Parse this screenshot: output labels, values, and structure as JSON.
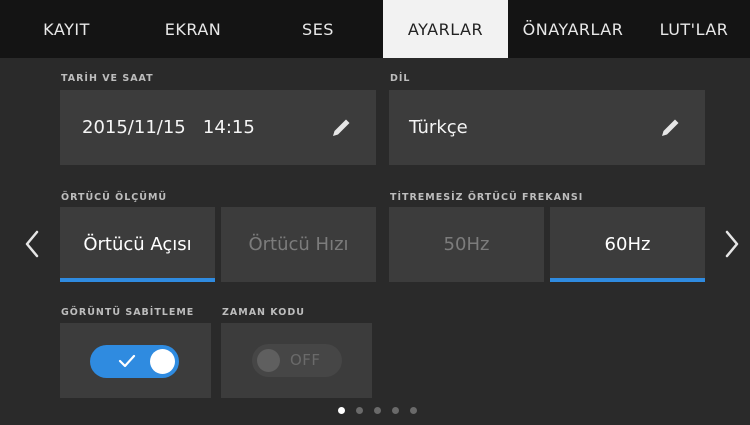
{
  "tabs": [
    {
      "label": "KAYIT",
      "active": false
    },
    {
      "label": "EKRAN",
      "active": false
    },
    {
      "label": "SES",
      "active": false
    },
    {
      "label": "AYARLAR",
      "active": true
    },
    {
      "label": "ÖNAYARLAR",
      "active": false
    },
    {
      "label": "LUT'LAR",
      "active": false
    }
  ],
  "date_time": {
    "label": "TARİH VE SAAT",
    "value": "2015/11/15   14:15",
    "edit_icon": "pencil-icon"
  },
  "language": {
    "label": "DİL",
    "value": "Türkçe",
    "edit_icon": "pencil-icon"
  },
  "shutter_measurement": {
    "label": "ÖRTÜCÜ ÖLÇÜMÜ",
    "options": [
      "Örtücü Açısı",
      "Örtücü Hızı"
    ],
    "selected": "Örtücü Açısı"
  },
  "flicker_free": {
    "label": "TİTREMESİZ ÖRTÜCÜ FREKANSI",
    "options": [
      "50Hz",
      "60Hz"
    ],
    "selected": "60Hz"
  },
  "image_stabilization": {
    "label": "GÖRÜNTÜ SABİTLEME",
    "state": "on",
    "icon": "check-icon"
  },
  "timecode": {
    "label": "ZAMAN KODU",
    "state": "OFF"
  },
  "navigation": {
    "prev_icon": "chevron-left-icon",
    "next_icon": "chevron-right-icon"
  },
  "pagination": {
    "pages": 5,
    "current": 1
  },
  "colors": {
    "accent": "#2f8be0",
    "background": "#2a2a2a",
    "tile": "#3c3c3c",
    "tabbar": "#141414"
  }
}
